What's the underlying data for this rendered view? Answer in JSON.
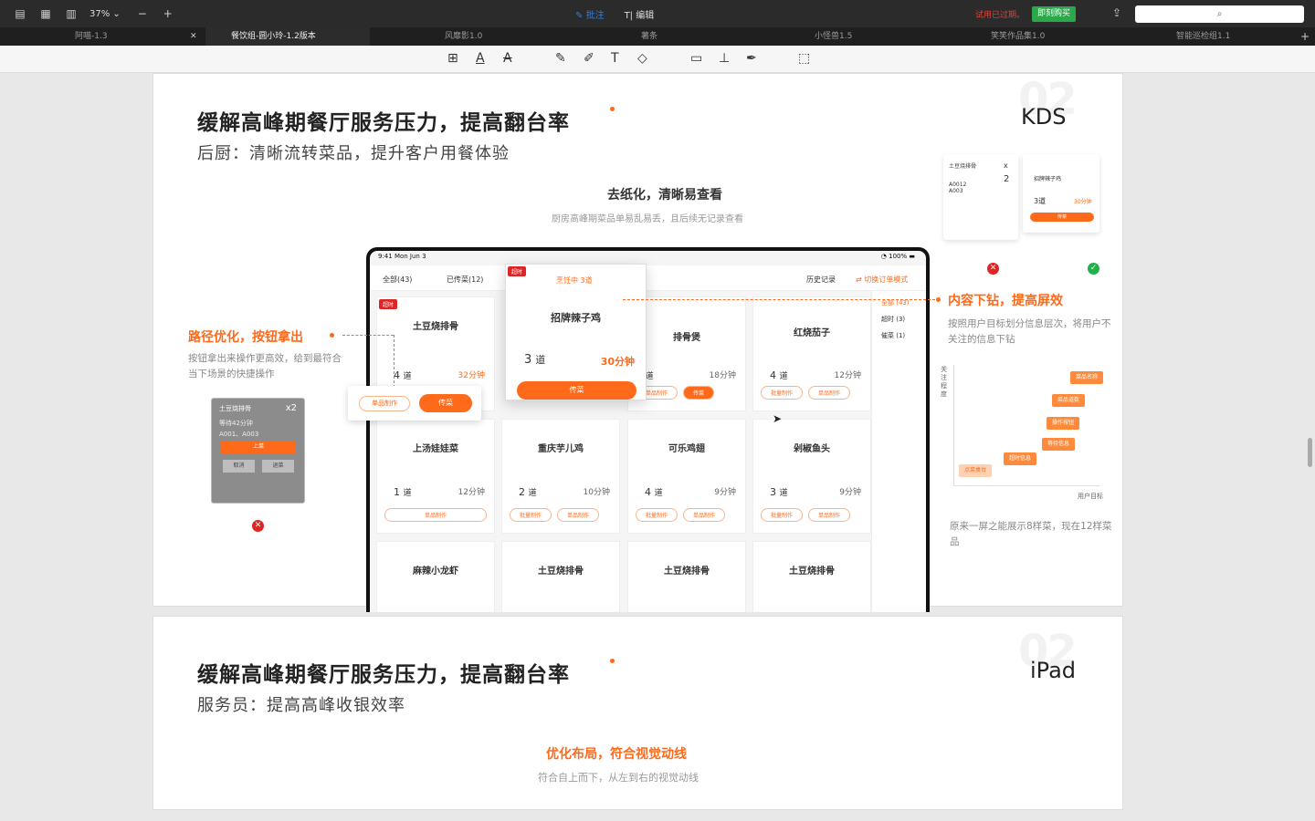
{
  "window": {
    "zoom": "37%",
    "mode_annotate": "批注",
    "mode_edit": "编辑",
    "trial_text": "试用已过期。",
    "buy_label": "即刻购买"
  },
  "tabs": [
    {
      "label": "阿喵-1.3"
    },
    {
      "label": "餐饮组-圆小玲-1.2版本"
    },
    {
      "label": "风靡影1.0"
    },
    {
      "label": "薯条"
    },
    {
      "label": "小怪兽1.5"
    },
    {
      "label": "笑笑作品集1.0"
    },
    {
      "label": "智能巡检组1.1"
    }
  ],
  "slide1": {
    "title": "缓解高峰期餐厅服务压力，提高翻台率",
    "subtitle": "后厨：清晰流转菜品，提升客户用餐体验",
    "bignum": "02",
    "tag": "KDS",
    "center_title": "去纸化，清晰易查看",
    "center_sub": "厨房高峰期菜品单易乱易丢，且后续无记录查看",
    "left_title": "路径优化，按钮拿出",
    "left_desc": "按钮拿出来操作更高效，给到最符合当下场景的快捷操作",
    "right_title": "内容下钻，提高屏效",
    "right_desc": "按照用户目标划分信息层次，将用户不关注的信息下钻",
    "bottom_note": "原来一屏之能展示8样菜，现在12样菜品",
    "chart_ylabel": "关注程度",
    "chart_xlabel": "用户目标",
    "chart_pills": [
      "菜品名称",
      "菜品道数",
      "操作按钮",
      "等待信息",
      "超时信息",
      "点菜桌台"
    ]
  },
  "ipad": {
    "time": "9:41  Mon Jun 3",
    "battery": "100%",
    "tab_all": "全部(43)",
    "tab_done": "已传菜(12)",
    "tab_history": "历史记录",
    "tab_switch": "⇄ 切换订单模式",
    "side": [
      "全部 (43)",
      "超时 (3)",
      "催菜 (1)"
    ],
    "highlight": {
      "name": "招牌辣子鸡",
      "qty": "3",
      "unit": "道",
      "wait": "30分钟",
      "action": "传菜",
      "badge": "超时",
      "cooking": "烹饪中 3道"
    },
    "cards": [
      {
        "name": "土豆烧排骨",
        "qty": "4",
        "time": "32分钟"
      },
      {
        "name": "排骨煲",
        "qty": "2",
        "time": "18分钟"
      },
      {
        "name": "红烧茄子",
        "qty": "4",
        "time": "12分钟"
      },
      {
        "name": "上汤娃娃菜",
        "qty": "1",
        "time": "12分钟"
      },
      {
        "name": "重庆芋儿鸡",
        "qty": "2",
        "time": "10分钟"
      },
      {
        "name": "可乐鸡翅",
        "qty": "4",
        "time": "9分钟"
      },
      {
        "name": "剁椒鱼头",
        "qty": "3",
        "time": "9分钟"
      },
      {
        "name": "麻辣小龙虾"
      },
      {
        "name": "土豆烧排骨"
      },
      {
        "name": "土豆烧排骨"
      },
      {
        "name": "土豆烧排骨"
      }
    ],
    "unit": "道",
    "btn_batch": "批量制作",
    "btn_single": "单品制作",
    "btn_serve": "传菜"
  },
  "popup": {
    "single": "单品制作",
    "serve": "传菜"
  },
  "old_card": {
    "name": "土豆烧排骨",
    "count": "x2",
    "wait": "等待42分钟",
    "orders": "A001、A003",
    "btn_serve": "上菜",
    "btn_cancel": "取消",
    "btn_return": "退菜"
  },
  "right_mini": {
    "name": "土豆烧排骨",
    "count": "x",
    "count2": "2",
    "orders": "A0012\nA003",
    "name2": "招牌辣子鸡",
    "qty": "3",
    "unit": "道",
    "wait": "30分钟",
    "btn": "传菜"
  },
  "slide2": {
    "title": "缓解高峰期餐厅服务压力，提高翻台率",
    "subtitle": "服务员：提高高峰收银效率",
    "bignum": "02",
    "tag": "iPad",
    "center_title": "优化布局，符合视觉动线",
    "center_sub": "符合自上而下，从左到右的视觉动线"
  },
  "colors": {
    "accent": "#ff6a1a",
    "danger": "#e02424",
    "success": "#20b04b",
    "link": "#3a7bd5"
  }
}
